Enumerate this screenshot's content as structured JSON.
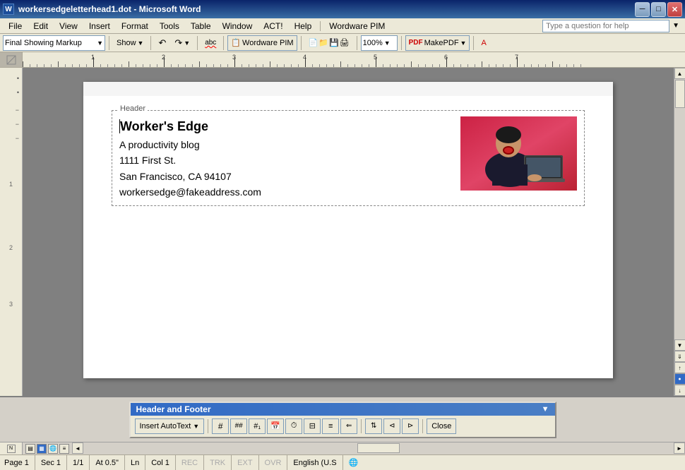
{
  "titlebar": {
    "icon": "W",
    "title": "workersedgeletterhead1.dot - Microsoft Word",
    "min_btn": "─",
    "max_btn": "□",
    "close_btn": "✕"
  },
  "menubar": {
    "items": [
      "File",
      "Edit",
      "View",
      "Insert",
      "Format",
      "Tools",
      "Table",
      "Window",
      "ACT!",
      "Help",
      "Wordware PIM"
    ]
  },
  "toolbar1": {
    "style_dropdown": "Final Showing Markup",
    "show_btn": "Show",
    "zoom_value": "100%",
    "makepdf_btn": "MakePDF"
  },
  "help_box": {
    "placeholder": "Type a question for help"
  },
  "document": {
    "header_label": "Header",
    "lines": [
      "Worker's Edge",
      "A productivity blog",
      "1111 First St.",
      "San Francisco, CA 94107",
      "workersedge@fakeaddress.com"
    ]
  },
  "hf_toolbar": {
    "title": "Header and Footer",
    "insert_autotext_btn": "Insert AutoText",
    "close_btn": "Close",
    "icons": [
      "⇢",
      "↵",
      "↻",
      "⊞",
      "⏱",
      "⊟",
      "⊠",
      "≡",
      "⊡",
      "⊢",
      "⊣",
      "✕"
    ]
  },
  "statusbar": {
    "page": "Page  1",
    "sec": "Sec  1",
    "page_of": "1/1",
    "at": "At  0.5\"",
    "ln": "Ln",
    "col": "Col  1",
    "rec": "REC",
    "trk": "TRK",
    "ext": "EXT",
    "ovr": "OVR",
    "lang": "English (U.S"
  },
  "ruler": {
    "numbers": [
      " ",
      "1",
      " ",
      "2",
      " ",
      "3",
      " ",
      "4",
      " ",
      "5",
      " ",
      "6",
      " ",
      "7"
    ]
  }
}
